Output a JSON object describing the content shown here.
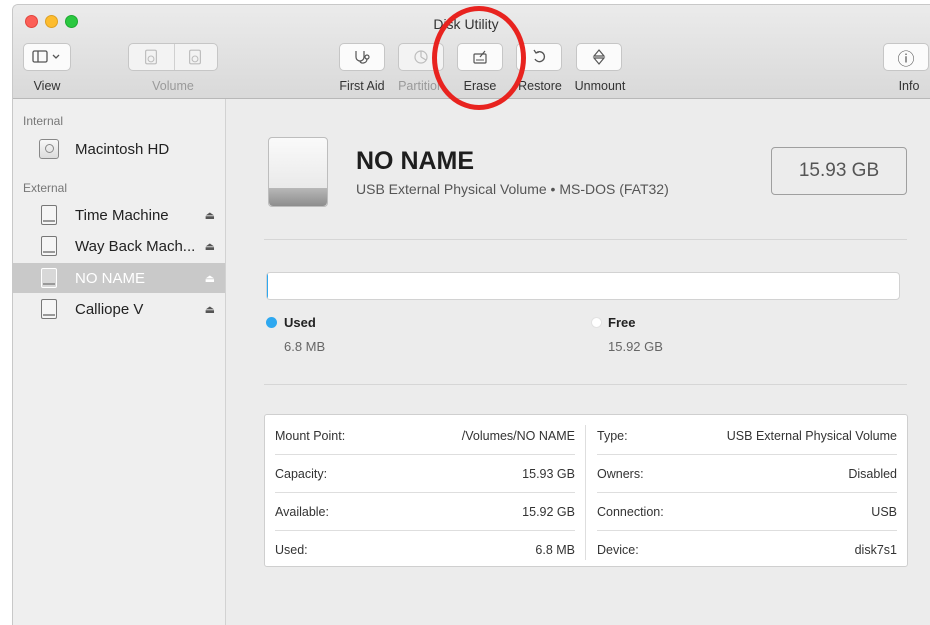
{
  "window": {
    "title": "Disk Utility"
  },
  "toolbar": {
    "view_label": "View",
    "volume_label": "Volume",
    "first_aid_label": "First Aid",
    "partition_label": "Partition",
    "erase_label": "Erase",
    "restore_label": "Restore",
    "unmount_label": "Unmount",
    "info_label": "Info",
    "info_icon": "ⓘ"
  },
  "sidebar": {
    "internal_header": "Internal",
    "external_header": "External",
    "internal_items": [
      {
        "label": "Macintosh HD"
      }
    ],
    "external_items": [
      {
        "label": "Time Machine",
        "eject": "⏏"
      },
      {
        "label": "Way Back Mach...",
        "eject": "⏏"
      },
      {
        "label": "NO NAME",
        "eject": "⏏",
        "selected": true
      },
      {
        "label": "Calliope V",
        "eject": "⏏"
      }
    ]
  },
  "volume": {
    "name": "NO NAME",
    "subtitle": "USB External Physical Volume • MS-DOS (FAT32)",
    "size": "15.93 GB",
    "used_fraction": 0.0004
  },
  "usage": {
    "used_label": "Used",
    "used_value": "6.8 MB",
    "free_label": "Free",
    "free_value": "15.92 GB",
    "used_color": "#2ea8f0"
  },
  "info": {
    "left": [
      {
        "key": "Mount Point:",
        "value": "/Volumes/NO NAME"
      },
      {
        "key": "Capacity:",
        "value": "15.93 GB"
      },
      {
        "key": "Available:",
        "value": "15.92 GB"
      },
      {
        "key": "Used:",
        "value": "6.8 MB"
      }
    ],
    "right": [
      {
        "key": "Type:",
        "value": "USB External Physical Volume"
      },
      {
        "key": "Owners:",
        "value": "Disabled"
      },
      {
        "key": "Connection:",
        "value": "USB"
      },
      {
        "key": "Device:",
        "value": "disk7s1"
      }
    ]
  },
  "annotation": {
    "color": "#e8231f"
  }
}
